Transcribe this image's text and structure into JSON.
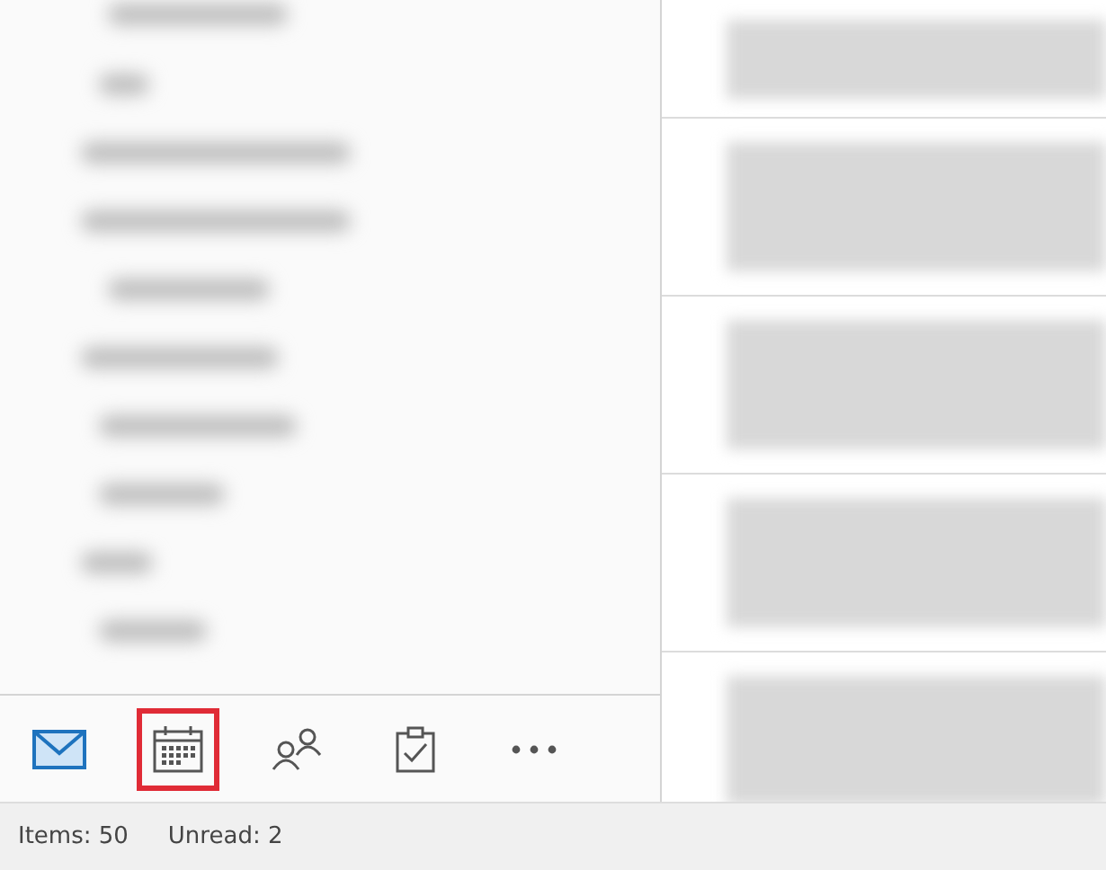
{
  "navigation": [
    {
      "kind": "mail",
      "selected": true,
      "highlighted": false
    },
    {
      "kind": "calendar",
      "selected": false,
      "highlighted": true
    },
    {
      "kind": "people",
      "selected": false,
      "highlighted": false
    },
    {
      "kind": "tasks",
      "selected": false,
      "highlighted": false
    },
    {
      "kind": "more",
      "selected": false,
      "highlighted": false
    }
  ],
  "status_bar": {
    "items": "Items: 50",
    "unread": "Unread: 2"
  }
}
